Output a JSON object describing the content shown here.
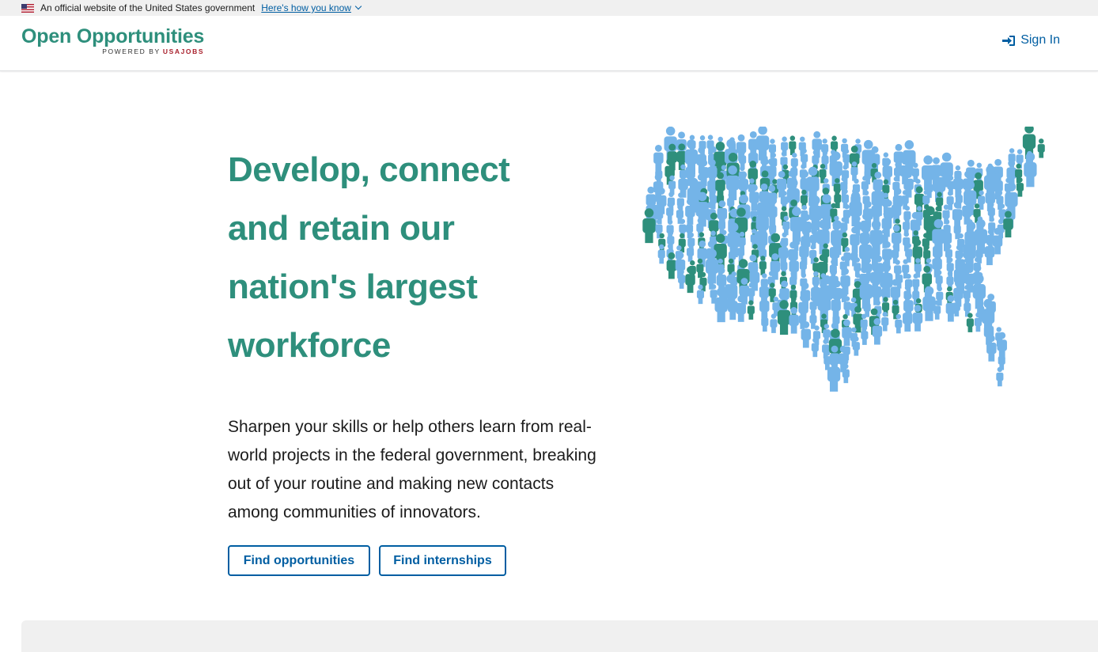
{
  "gov_banner": {
    "text": "An official website of the United States government",
    "link": "Here's how you know"
  },
  "header": {
    "logo_title": "Open Opportunities",
    "logo_powered": "POWERED BY",
    "logo_usajobs": "USAJOBS",
    "signin_label": "Sign In"
  },
  "hero": {
    "title": "Develop, connect and retain our nation's largest workforce",
    "body": "Sharpen your skills or help others learn from real-world projects in the federal government, breaking out of your routine and making new contacts among communities of innovators.",
    "buttons": {
      "opportunities": "Find opportunities",
      "internships": "Find internships"
    }
  },
  "colors": {
    "brand_green": "#2e8f7c",
    "link_blue": "#005ea2",
    "person_blue": "#74b4e8",
    "usajobs_red": "#a8202c"
  }
}
